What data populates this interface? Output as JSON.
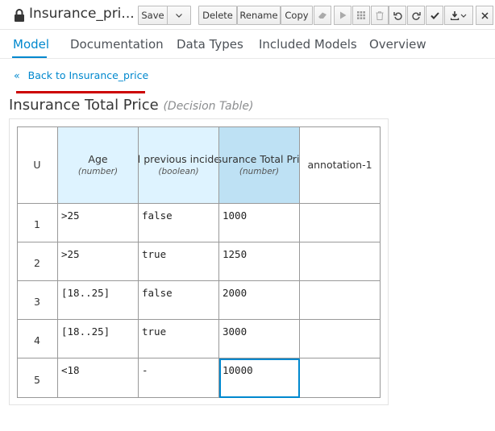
{
  "header": {
    "title": "Insurance_pri...",
    "buttons": {
      "save": "Save",
      "delete": "Delete",
      "rename": "Rename",
      "copy": "Copy"
    }
  },
  "tabs": [
    {
      "label": "Model"
    },
    {
      "label": "Documentation"
    },
    {
      "label": "Data Types"
    },
    {
      "label": "Included Models"
    },
    {
      "label": "Overview"
    }
  ],
  "back_link": {
    "label": "Back to Insurance_price"
  },
  "decision_table": {
    "name": "Insurance Total Price",
    "kind": "(Decision Table)",
    "hit_policy": "U",
    "columns": [
      {
        "name": "Age",
        "type": "(number)"
      },
      {
        "name": "had previous incidents",
        "type": "(boolean)"
      },
      {
        "name": "Insurance Total Price",
        "type": "(number)"
      },
      {
        "name": "annotation-1",
        "type": ""
      }
    ],
    "rows": [
      {
        "num": "1",
        "age": ">25",
        "incidents": "false",
        "price": "1000",
        "annotation": ""
      },
      {
        "num": "2",
        "age": ">25",
        "incidents": "true",
        "price": "1250",
        "annotation": ""
      },
      {
        "num": "3",
        "age": "[18..25]",
        "incidents": "false",
        "price": "2000",
        "annotation": ""
      },
      {
        "num": "4",
        "age": "[18..25]",
        "incidents": "true",
        "price": "3000",
        "annotation": ""
      },
      {
        "num": "5",
        "age": "<18",
        "incidents": "-",
        "price": "10000",
        "annotation": ""
      }
    ]
  },
  "colors": {
    "accent": "#0088ce",
    "input_header": "#def3ff",
    "output_header": "#bee1f4",
    "back_bar": "#cc0000"
  }
}
